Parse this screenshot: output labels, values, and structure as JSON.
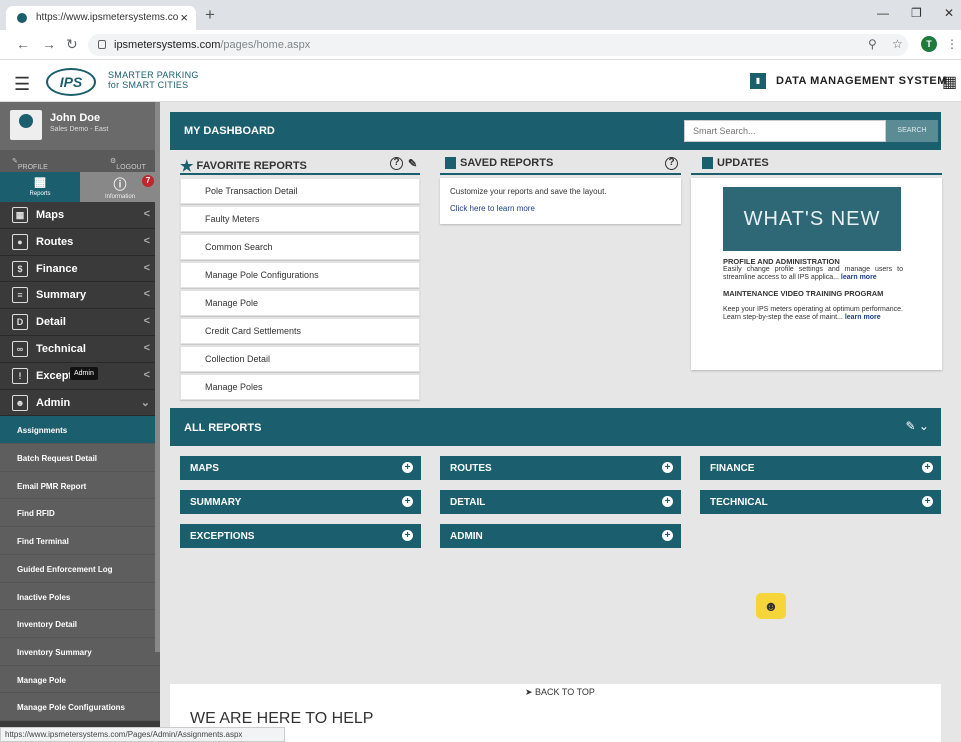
{
  "browser": {
    "tab_title": "https://www.ipsmetersystems.co",
    "tab_close": "×",
    "new_tab": "+",
    "url_host": "ipsmetersystems.com",
    "url_path": "/pages/home.aspx",
    "profile_initial": "T",
    "status_url": "https://www.ipsmetersystems.com/Pages/Admin/Assignments.aspx"
  },
  "header": {
    "logo_text": "IPS",
    "tagline_1": "SMARTER PARKING",
    "tagline_2": "for SMART CITIES",
    "system_title": "DATA MANAGEMENT SYSTEM"
  },
  "sidebar": {
    "user_name": "John Doe",
    "user_role": "Sales Demo - East",
    "profile_label": "PROFILE",
    "logout_label": "LOGOUT",
    "reports_label": "Reports",
    "information_label": "Information",
    "notification_count": "7",
    "nav": [
      {
        "label": "Maps",
        "icon": "map-icon"
      },
      {
        "label": "Routes",
        "icon": "route-icon"
      },
      {
        "label": "Finance",
        "icon": "finance-icon"
      },
      {
        "label": "Summary",
        "icon": "summary-icon"
      },
      {
        "label": "Detail",
        "icon": "detail-icon"
      },
      {
        "label": "Technical",
        "icon": "wrench-icon"
      },
      {
        "label": "Except",
        "icon": "exception-icon"
      },
      {
        "label": "Admin",
        "icon": "admin-icon"
      }
    ],
    "tooltip": "Admin",
    "sub_items": [
      "Assignments",
      "Batch Request Detail",
      "Email PMR Report",
      "Find RFID",
      "Find Terminal",
      "Guided Enforcement Log",
      "Inactive Poles",
      "Inventory Detail",
      "Inventory Summary",
      "Manage Pole",
      "Manage Pole Configurations"
    ]
  },
  "dashboard": {
    "title": "MY DASHBOARD",
    "search_placeholder": "Smart Search...",
    "search_button": "SEARCH",
    "favorite_title": "FAVORITE REPORTS",
    "favorites": [
      "Pole Transaction Detail",
      "Faulty Meters",
      "Common Search",
      "Manage Pole Configurations",
      "Manage Pole",
      "Credit Card Settlements",
      "Collection Detail",
      "Manage Poles"
    ],
    "saved_title": "SAVED REPORTS",
    "saved_text": "Customize your reports and save the layout.",
    "saved_link": "Click here to learn more",
    "updates_title": "UPDATES",
    "whats_new": "WHAT'S NEW",
    "upd1_title": "PROFILE AND ADMINISTRATION",
    "upd1_text": "Easily change profile settings and manage users to streamline access to all IPS applica...",
    "upd1_link": "learn more",
    "upd2_title": "MAINTENANCE VIDEO TRAINING PROGRAM",
    "upd2_text": "Keep your IPS meters operating at optimum performance. Learn step-by-step the ease of maint...",
    "upd2_link": "learn more"
  },
  "all_reports": {
    "title": "ALL REPORTS",
    "buttons": [
      "MAPS",
      "ROUTES",
      "FINANCE",
      "SUMMARY",
      "DETAIL",
      "TECHNICAL",
      "EXCEPTIONS",
      "ADMIN"
    ]
  },
  "footer": {
    "back_to_top": "BACK TO TOP",
    "help_title": "WE ARE HERE TO HELP"
  },
  "colors": {
    "brand": "#1b5e6d",
    "sidebar": "#3a3a3a",
    "badge": "#c0262b",
    "chat": "#f5d53a"
  }
}
